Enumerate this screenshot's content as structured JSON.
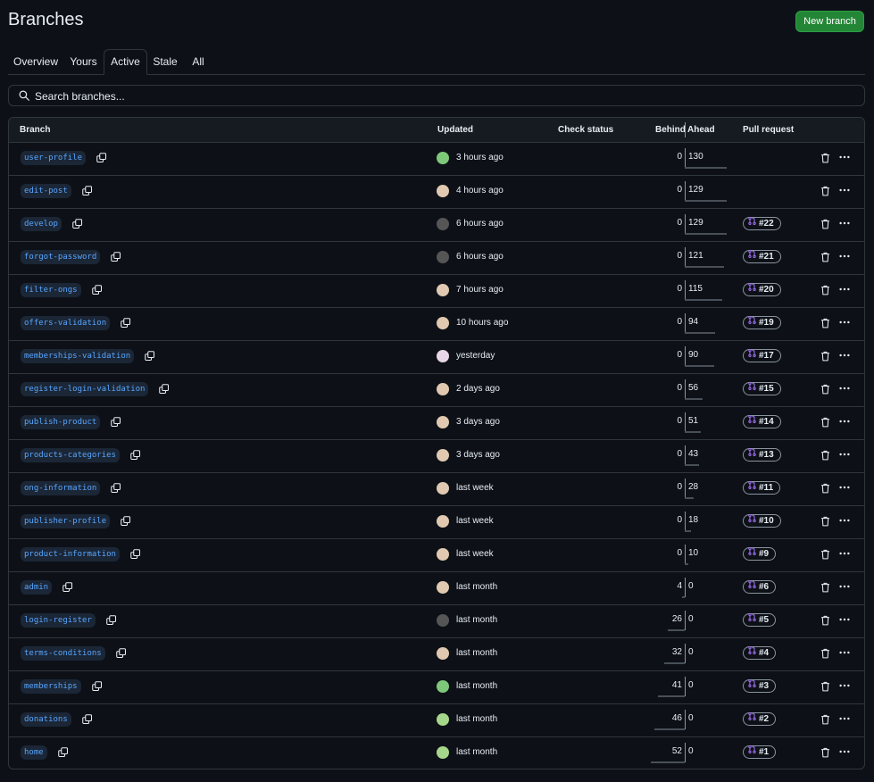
{
  "header": {
    "title": "Branches",
    "new_branch_label": "New branch"
  },
  "tabs": [
    {
      "label": "Overview",
      "selected": false
    },
    {
      "label": "Yours",
      "selected": false
    },
    {
      "label": "Active",
      "selected": true
    },
    {
      "label": "Stale",
      "selected": false
    },
    {
      "label": "All",
      "selected": false
    }
  ],
  "search": {
    "placeholder": "Search branches..."
  },
  "table": {
    "headers": {
      "branch": "Branch",
      "updated": "Updated",
      "check_status": "Check status",
      "behind": "Behind",
      "ahead": "Ahead",
      "pull_request": "Pull request"
    },
    "rows": [
      {
        "name": "user-profile",
        "updated": "3 hours ago",
        "avatar_color": "#7ec87a",
        "behind": "0",
        "ahead": "130",
        "pr": ""
      },
      {
        "name": "edit-post",
        "updated": "4 hours ago",
        "avatar_color": "#e0c9b0",
        "behind": "0",
        "ahead": "129",
        "pr": ""
      },
      {
        "name": "develop",
        "updated": "6 hours ago",
        "avatar_color": "#555555",
        "behind": "0",
        "ahead": "129",
        "pr": "#22"
      },
      {
        "name": "forgot-password",
        "updated": "6 hours ago",
        "avatar_color": "#555555",
        "behind": "0",
        "ahead": "121",
        "pr": "#21"
      },
      {
        "name": "filter-ongs",
        "updated": "7 hours ago",
        "avatar_color": "#e0c9b0",
        "behind": "0",
        "ahead": "115",
        "pr": "#20"
      },
      {
        "name": "offers-validation",
        "updated": "10 hours ago",
        "avatar_color": "#e0c9b0",
        "behind": "0",
        "ahead": "94",
        "pr": "#19"
      },
      {
        "name": "memberships-validation",
        "updated": "yesterday",
        "avatar_color": "#e8d6e8",
        "behind": "0",
        "ahead": "90",
        "pr": "#17"
      },
      {
        "name": "register-login-validation",
        "updated": "2 days ago",
        "avatar_color": "#e0c9b0",
        "behind": "0",
        "ahead": "56",
        "pr": "#15"
      },
      {
        "name": "publish-product",
        "updated": "3 days ago",
        "avatar_color": "#e0c9b0",
        "behind": "0",
        "ahead": "51",
        "pr": "#14"
      },
      {
        "name": "products-categories",
        "updated": "3 days ago",
        "avatar_color": "#e0c9b0",
        "behind": "0",
        "ahead": "43",
        "pr": "#13"
      },
      {
        "name": "ong-information",
        "updated": "last week",
        "avatar_color": "#e0c9b0",
        "behind": "0",
        "ahead": "28",
        "pr": "#11"
      },
      {
        "name": "publisher-profile",
        "updated": "last week",
        "avatar_color": "#e0c9b0",
        "behind": "0",
        "ahead": "18",
        "pr": "#10"
      },
      {
        "name": "product-information",
        "updated": "last week",
        "avatar_color": "#e0c9b0",
        "behind": "0",
        "ahead": "10",
        "pr": "#9"
      },
      {
        "name": "admin",
        "updated": "last month",
        "avatar_color": "#e0c9b0",
        "behind": "4",
        "ahead": "0",
        "pr": "#6"
      },
      {
        "name": "login-register",
        "updated": "last month",
        "avatar_color": "#555555",
        "behind": "26",
        "ahead": "0",
        "pr": "#5"
      },
      {
        "name": "terms-conditions",
        "updated": "last month",
        "avatar_color": "#e0c9b0",
        "behind": "32",
        "ahead": "0",
        "pr": "#4"
      },
      {
        "name": "memberships",
        "updated": "last month",
        "avatar_color": "#7ec87a",
        "behind": "41",
        "ahead": "0",
        "pr": "#3"
      },
      {
        "name": "donations",
        "updated": "last month",
        "avatar_color": "#a6d68a",
        "behind": "46",
        "ahead": "0",
        "pr": "#2"
      },
      {
        "name": "home",
        "updated": "last month",
        "avatar_color": "#a6d68a",
        "behind": "52",
        "ahead": "0",
        "pr": "#1"
      }
    ]
  },
  "icons": {
    "search": "search-icon",
    "copy": "copy-icon",
    "delete": "trash-icon",
    "more": "kebab-horizontal-icon",
    "pull_request": "git-pull-request-icon"
  },
  "colors": {
    "background": "#0d1117",
    "header_bg": "#161b22",
    "border": "#30363d",
    "accent_link": "#58a6ff",
    "primary_button": "#238636",
    "chip_bg": "#1b2636"
  }
}
